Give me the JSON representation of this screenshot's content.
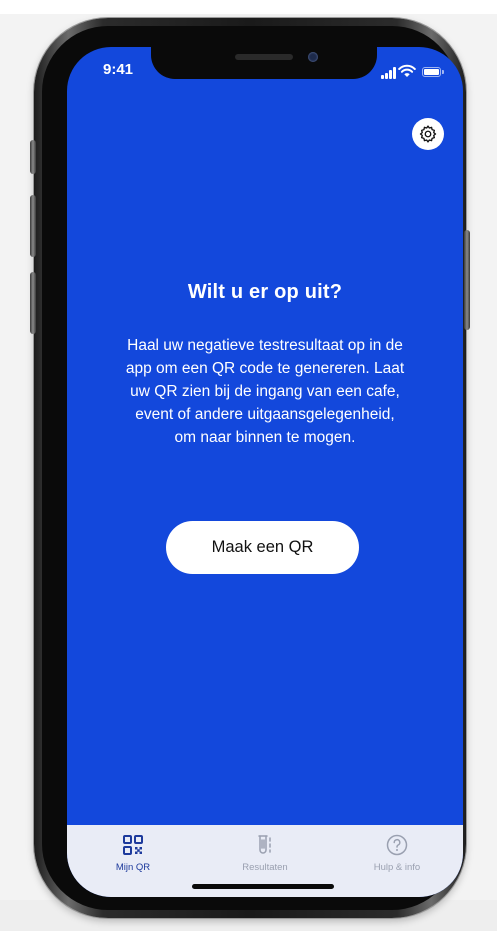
{
  "status_bar": {
    "time": "9:41"
  },
  "main": {
    "title": "Wilt u er op uit?",
    "body_lines": [
      "Haal uw negatieve testresultaat op in de",
      "app om een QR code te genereren. Laat",
      "uw QR zien bij de ingang van een cafe,",
      "event of andere uitgaansgelegenheid,",
      "om naar binnen te mogen."
    ],
    "cta_label": "Maak een QR"
  },
  "tabs": [
    {
      "label": "Mijn QR",
      "icon": "qr-code-icon",
      "active": true
    },
    {
      "label": "Resultaten",
      "icon": "test-tube-icon",
      "active": false
    },
    {
      "label": "Hulp & info",
      "icon": "help-circle-icon",
      "active": false
    }
  ],
  "settings": {
    "icon": "gear-icon"
  },
  "colors": {
    "screen_background": "#1348dc",
    "tabbar_background": "#e9ecf6",
    "active_tab": "#1d3a9c",
    "inactive_tab": "#9aa0b0",
    "button_background": "#ffffff"
  }
}
